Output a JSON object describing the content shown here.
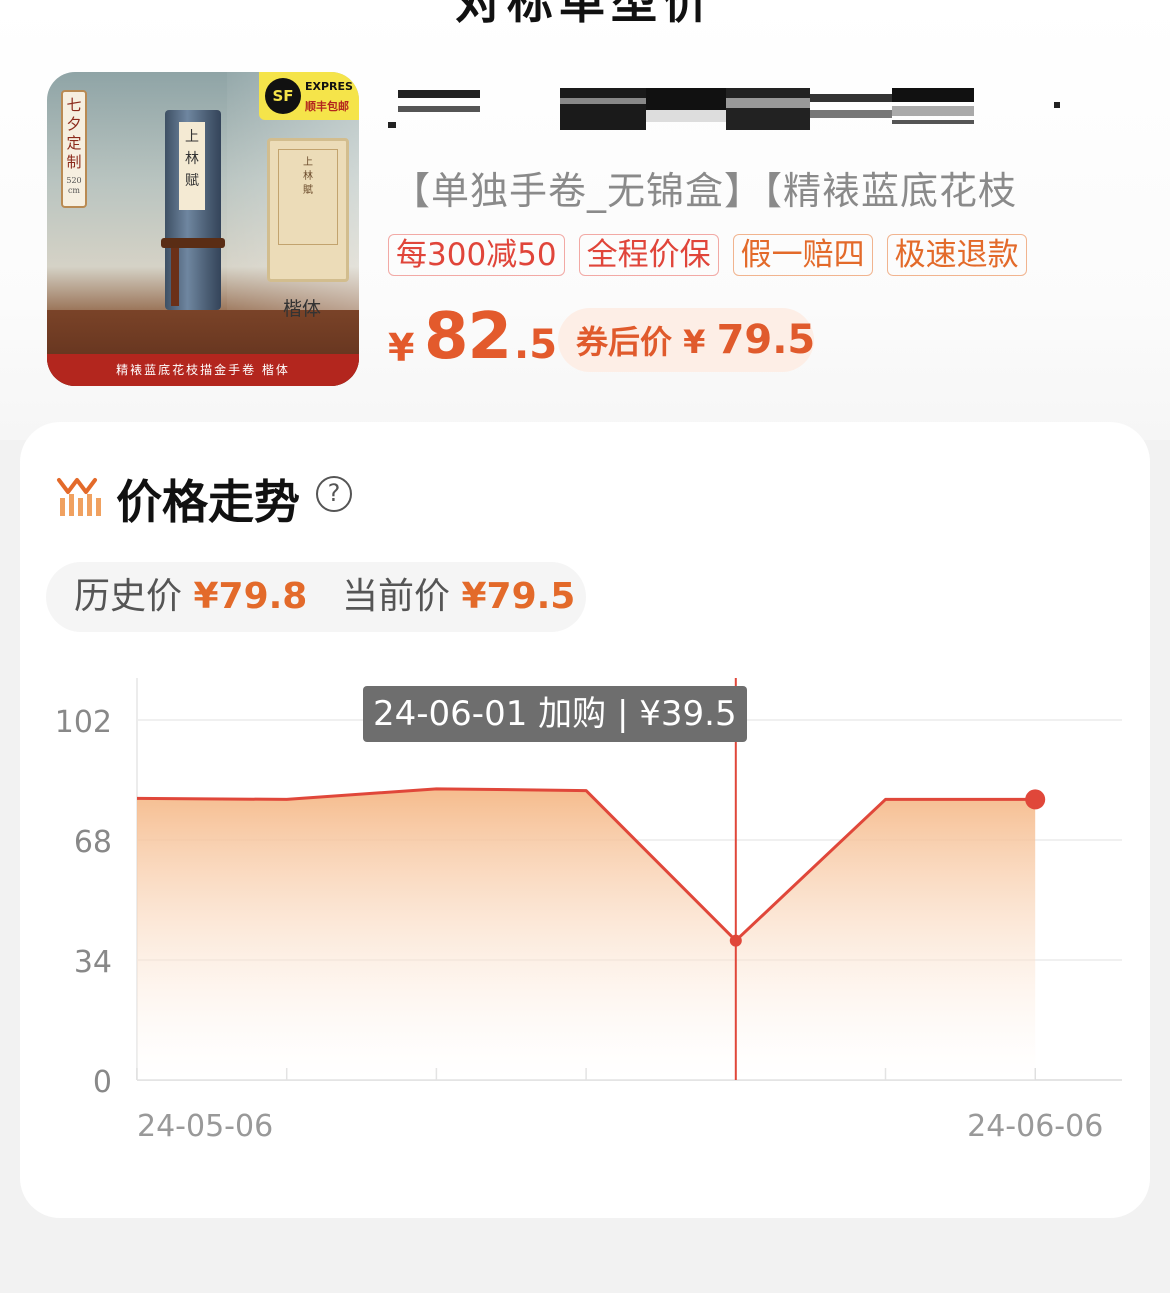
{
  "header": {
    "title_partial": "对标单型价"
  },
  "product": {
    "image": {
      "tag_text": "七夕定制",
      "tag_size": "520 cm",
      "scroll_label": "上林赋",
      "card_label": "上林賦",
      "style_caption": "楷体",
      "shipping_badge": {
        "logo": "SF",
        "line1": "EXPRES",
        "line2": "顺丰包邮"
      },
      "banner": "精裱蓝底花枝描金手卷    楷体"
    },
    "subtitle": "【单独手卷_无锦盒】【精裱蓝底花枝",
    "tags": [
      {
        "label": "每300减50",
        "style": "red"
      },
      {
        "label": "全程价保",
        "style": "red"
      },
      {
        "label": "假一赔四",
        "style": "orange"
      },
      {
        "label": "极速退款",
        "style": "orange"
      }
    ],
    "price": {
      "currency": "¥",
      "integer": "82",
      "decimal": ".5"
    },
    "coupon": {
      "label": "券后价",
      "currency": "¥",
      "amount": "79.5"
    }
  },
  "trend": {
    "title": "价格走势",
    "help_icon": "?",
    "history_label": "历史价",
    "history_value": "¥79.8",
    "current_label": "当前价",
    "current_value": "¥79.5"
  },
  "colors": {
    "accent": "#e35a2c",
    "line": "#e0473a",
    "fill_top": "#f5b887",
    "tag_red": "#e0453a",
    "tag_orange": "#e36a2a",
    "tooltip_bg": "#6e6e6e"
  },
  "chart_data": {
    "type": "area",
    "x_start_label": "24-05-06",
    "x_end_label": "24-06-06",
    "ylim": [
      0,
      102
    ],
    "y_ticks": [
      0,
      34,
      68,
      102
    ],
    "x_tick_count": 7,
    "series": [
      {
        "values": [
          79.8,
          79.5,
          82.5,
          82.0,
          39.5,
          79.5,
          79.5
        ]
      }
    ],
    "tooltip": {
      "date": "24-06-01",
      "event": "加购",
      "separator": "|",
      "price": "¥39.5",
      "index": 4
    },
    "last_point_marker": true,
    "grid": true
  }
}
